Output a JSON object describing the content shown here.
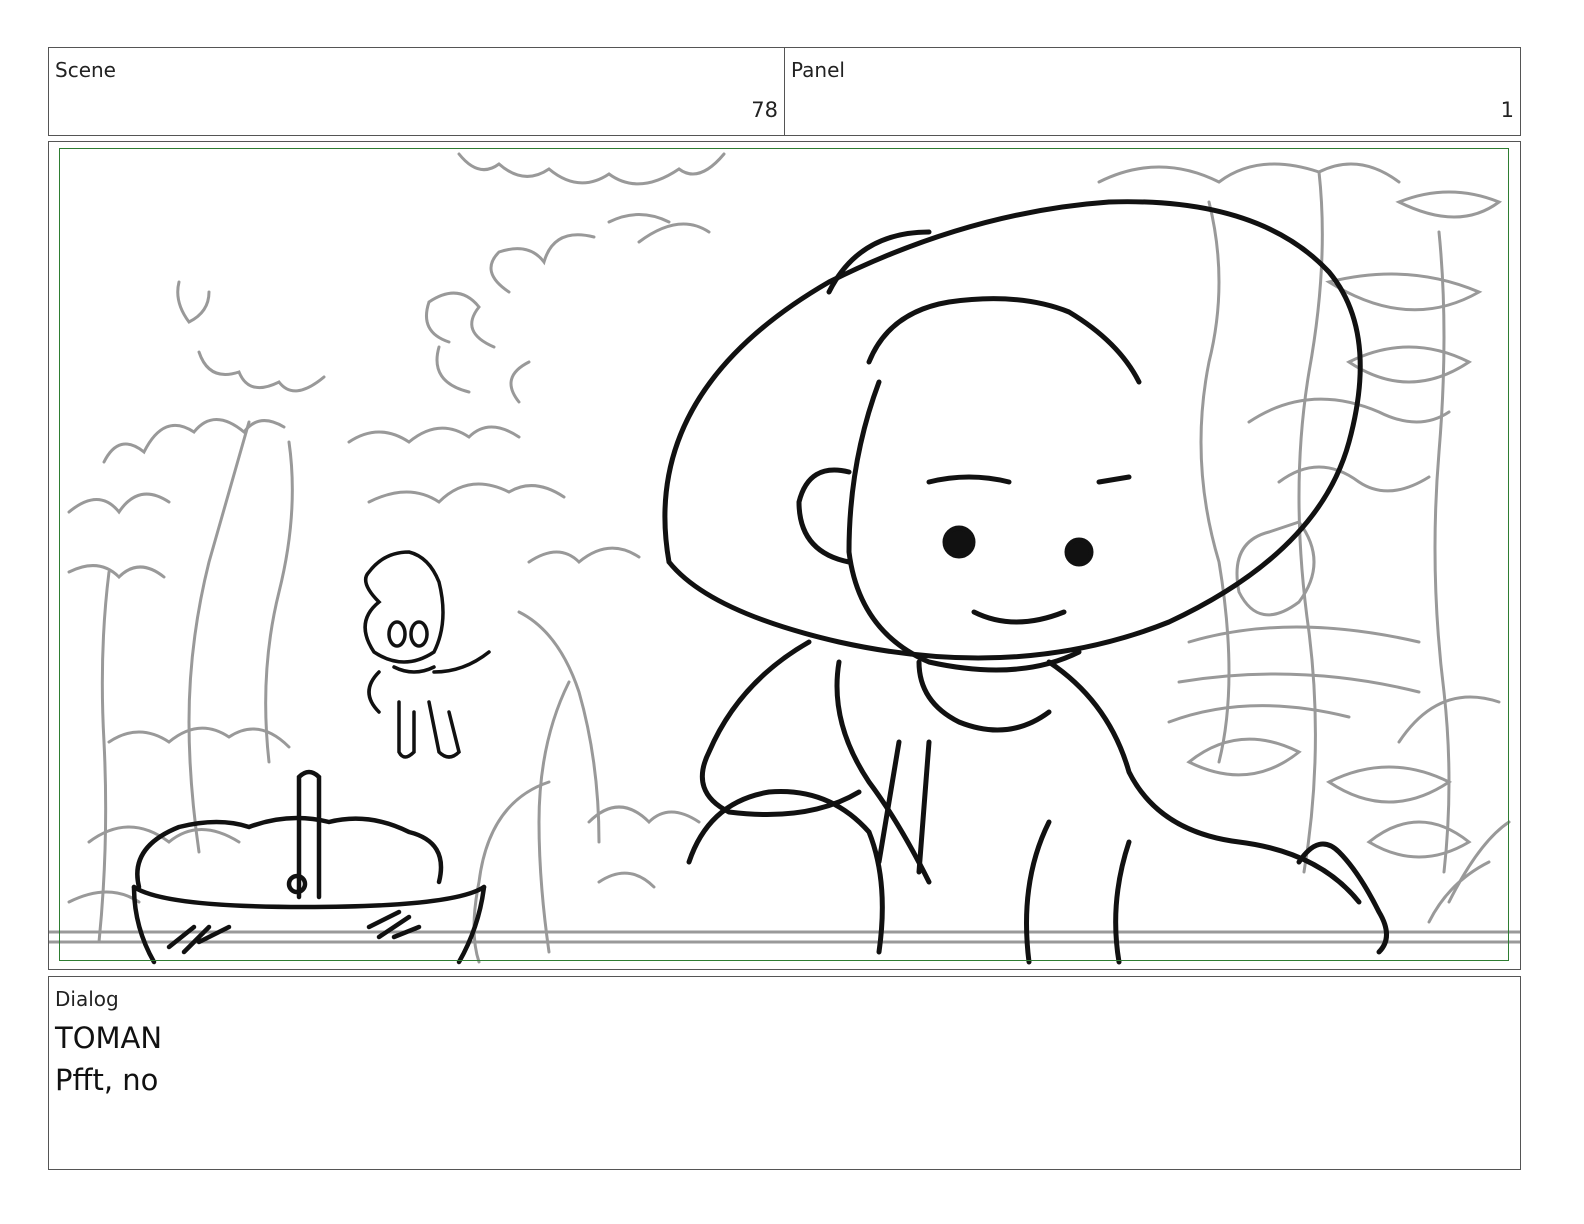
{
  "scene": {
    "label": "Scene",
    "value": "78"
  },
  "panel": {
    "label": "Panel",
    "value": "1"
  },
  "dialog": {
    "label": "Dialog",
    "speaker": "TOMAN",
    "line": "Pfft, no"
  },
  "colors": {
    "sketch_background": "#999999",
    "sketch_foreground": "#111111",
    "safe_area_border": "#2e7d32",
    "box_border": "#555555"
  },
  "drawing": {
    "icon": "storyboard-sketch-icon"
  }
}
